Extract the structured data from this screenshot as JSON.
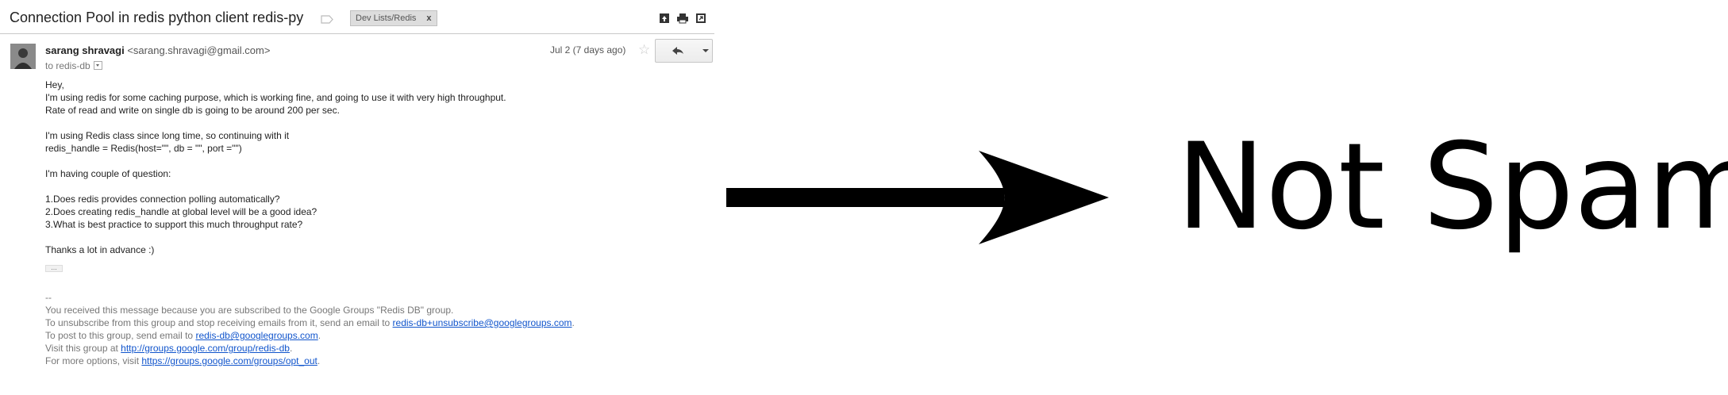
{
  "subject": "Connection Pool in redis python client redis-py",
  "label_chip": {
    "text": "Dev Lists/Redis",
    "remove": "x"
  },
  "toolbar_icons": [
    "archive-icon",
    "print-icon",
    "new-window-icon"
  ],
  "message": {
    "sender_name": "sarang shravagi",
    "sender_email": "<sarang.shravagi@gmail.com>",
    "to": "to redis-db",
    "date": "Jul 2 (7 days ago)",
    "body_lines": [
      "Hey,",
      "I'm using redis for some caching purpose, which is working fine, and going to use it with very high throughput.",
      "Rate of read and write on single db is going to be around 200 per sec.",
      "",
      "I'm using Redis class since long time, so continuing with it",
      "redis_handle = Redis(host=\"\", db = \"\", port =\"\")",
      "",
      "I'm having couple of question:",
      "",
      "1.Does redis provides connection polling automatically?",
      "2.Does creating redis_handle at global level will be a good idea?",
      "3.What is best practice to support this much throughput rate?",
      "",
      "Thanks a lot in advance :)"
    ],
    "ellipsis": "...",
    "footer": {
      "separator": "--",
      "line1": "You received this message because you are subscribed to the Google Groups \"Redis DB\" group.",
      "line2_text": "To unsubscribe from this group and stop receiving emails from it, send an email to ",
      "line2_link": "redis-db+unsubscribe@googlegroups.com",
      "line2_end": ".",
      "line3_text": "To post to this group, send email to ",
      "line3_link": "redis-db@googlegroups.com",
      "line3_end": ".",
      "line4_text": "Visit this group at ",
      "line4_link": "http://groups.google.com/group/redis-db",
      "line4_end": ".",
      "line5_text": "For more options, visit ",
      "line5_link": "https://groups.google.com/groups/opt_out",
      "line5_end": "."
    }
  },
  "annotation": {
    "text": "Not Spam"
  },
  "colors": {
    "link": "#1155cc",
    "label_chip": "#dddddd",
    "arrow": "#000000"
  }
}
